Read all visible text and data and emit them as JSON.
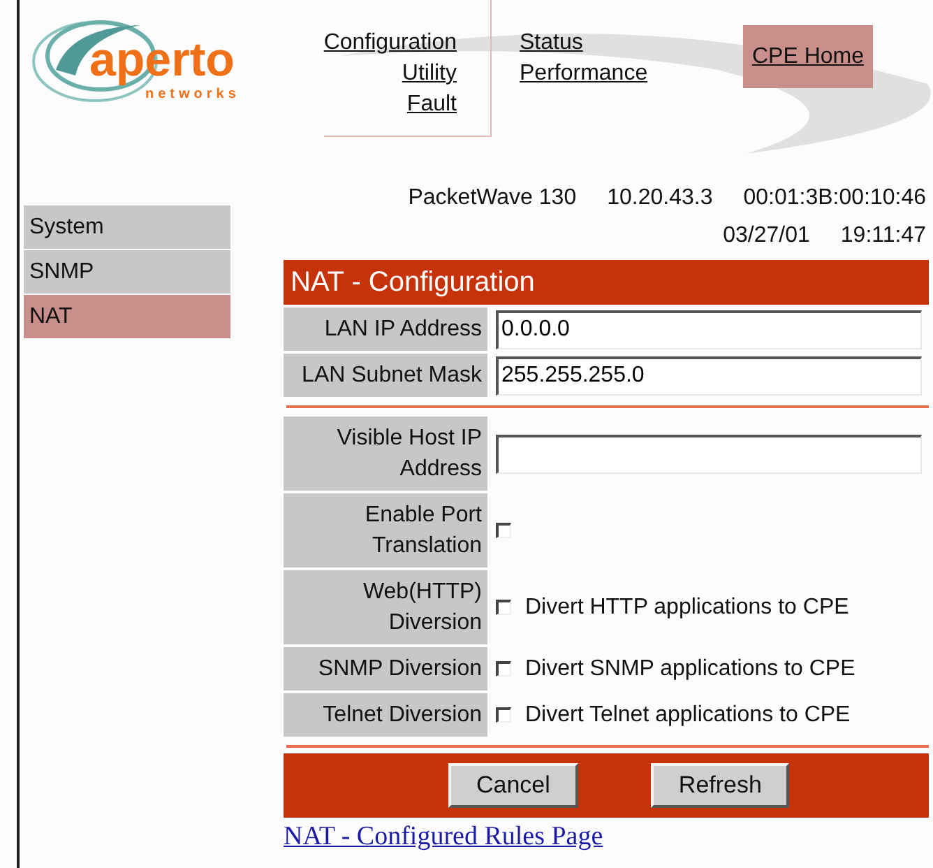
{
  "logo": {
    "name": "aperto",
    "tagline": "networks"
  },
  "nav": {
    "columns": [
      [
        "Configuration",
        "Utility",
        "Fault"
      ],
      [
        "Status",
        "Performance"
      ]
    ],
    "home": "CPE Home"
  },
  "sidebar": {
    "items": [
      {
        "label": "System",
        "selected": false
      },
      {
        "label": "SNMP",
        "selected": false
      },
      {
        "label": "NAT",
        "selected": true
      }
    ]
  },
  "device": {
    "line_1": [
      "PacketWave 130",
      "10.20.43.3",
      "00:01:3B:00:10:46"
    ],
    "line_2": [
      "03/27/01",
      "19:11:47"
    ]
  },
  "form": {
    "title": "NAT - Configuration",
    "groups": [
      [
        {
          "kind": "text",
          "label": "LAN IP Address",
          "value": "0.0.0.0"
        },
        {
          "kind": "text",
          "label": "LAN Subnet Mask",
          "value": "255.255.255.0"
        }
      ],
      [
        {
          "kind": "text",
          "label": "Visible Host IP Address"
        },
        {
          "kind": "checkbox",
          "label": "Enable Port Translation",
          "checked": false
        },
        {
          "kind": "checkbox",
          "label": "Web(HTTP) Diversion",
          "checked": false,
          "text": "Divert HTTP applications to CPE"
        },
        {
          "kind": "checkbox",
          "label": "SNMP Diversion",
          "checked": false,
          "text": "Divert SNMP applications to CPE"
        },
        {
          "kind": "checkbox",
          "label": "Telnet Diversion",
          "checked": false,
          "text": "Divert Telnet applications to CPE"
        }
      ]
    ],
    "buttons": [
      "Cancel",
      "Refresh"
    ],
    "link": "NAT - Configured Rules Page"
  }
}
